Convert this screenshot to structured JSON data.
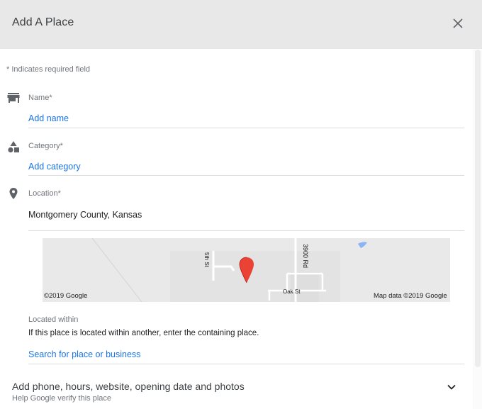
{
  "dialog": {
    "title": "Add A Place",
    "close_icon": "close-icon"
  },
  "required_note": "* Indicates required field",
  "fields": {
    "name": {
      "label": "Name*",
      "value": "Add name",
      "icon": "storefront-icon"
    },
    "category": {
      "label": "Category*",
      "value": "Add category",
      "icon": "category-shapes-icon"
    },
    "location": {
      "label": "Location*",
      "value": "Montgomery County, Kansas",
      "icon": "location-pin-icon"
    }
  },
  "map": {
    "copyright": "©2019 Google",
    "attribution": "Map data ©2019 Google",
    "road_labels": {
      "fifth_st": "5th St",
      "rd_3900": "3900 Rd",
      "oak_st": "Oak St"
    },
    "marker_icon": "red-map-marker-icon"
  },
  "located_within": {
    "label": "Located within",
    "description": "If this place is located within another, enter the containing place.",
    "placeholder": "Search for place or business"
  },
  "more_details": {
    "title": "Add phone, hours, website, opening date and photos",
    "subtitle": "Help Google verify this place",
    "icon": "chevron-down-icon"
  },
  "colors": {
    "link": "#1a73e8",
    "header_bg": "#e8e8e8",
    "marker": "#ea4335"
  }
}
